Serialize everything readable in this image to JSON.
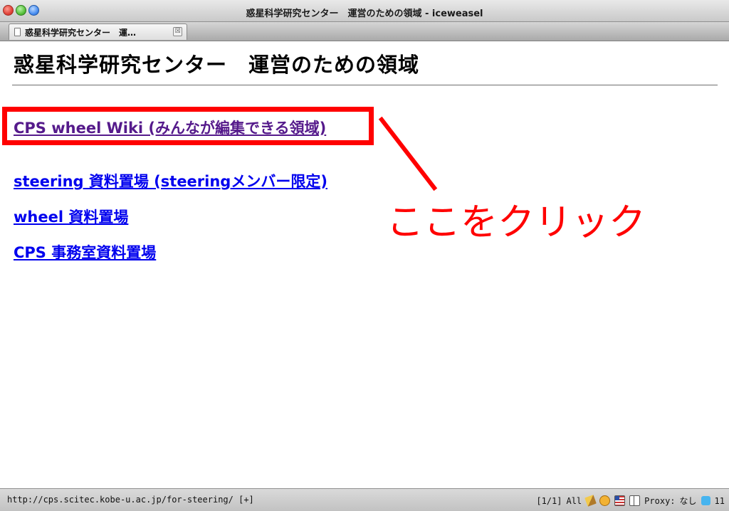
{
  "window": {
    "title": "惑星科学研究センター　運営のための領域 - iceweasel"
  },
  "tab": {
    "label": "惑星科学研究センター　運…",
    "close_symbol": "☒"
  },
  "page": {
    "heading": "惑星科学研究センター　運営のための領域",
    "links": [
      {
        "label": "CPS wheel Wiki (みんなが編集できる領域)",
        "visited": true
      },
      {
        "label": "steering 資料置場 (steeringメンバー限定)",
        "visited": false
      },
      {
        "label": "wheel 資料置場",
        "visited": false
      },
      {
        "label": "CPS 事務室資料置場",
        "visited": false
      }
    ]
  },
  "annotation": {
    "text": "ここをクリック",
    "color": "#ff0000"
  },
  "statusbar": {
    "url": "http://cps.scitec.kobe-u.ac.jp/for-steering/ [+]",
    "position": "[1/1]",
    "scroll": "All",
    "proxy_label": "Proxy:",
    "proxy_value": "なし",
    "twitter_count": "11"
  },
  "colors": {
    "link": "#0000ee",
    "visited_link": "#551a8b",
    "highlight": "#ff0000"
  }
}
